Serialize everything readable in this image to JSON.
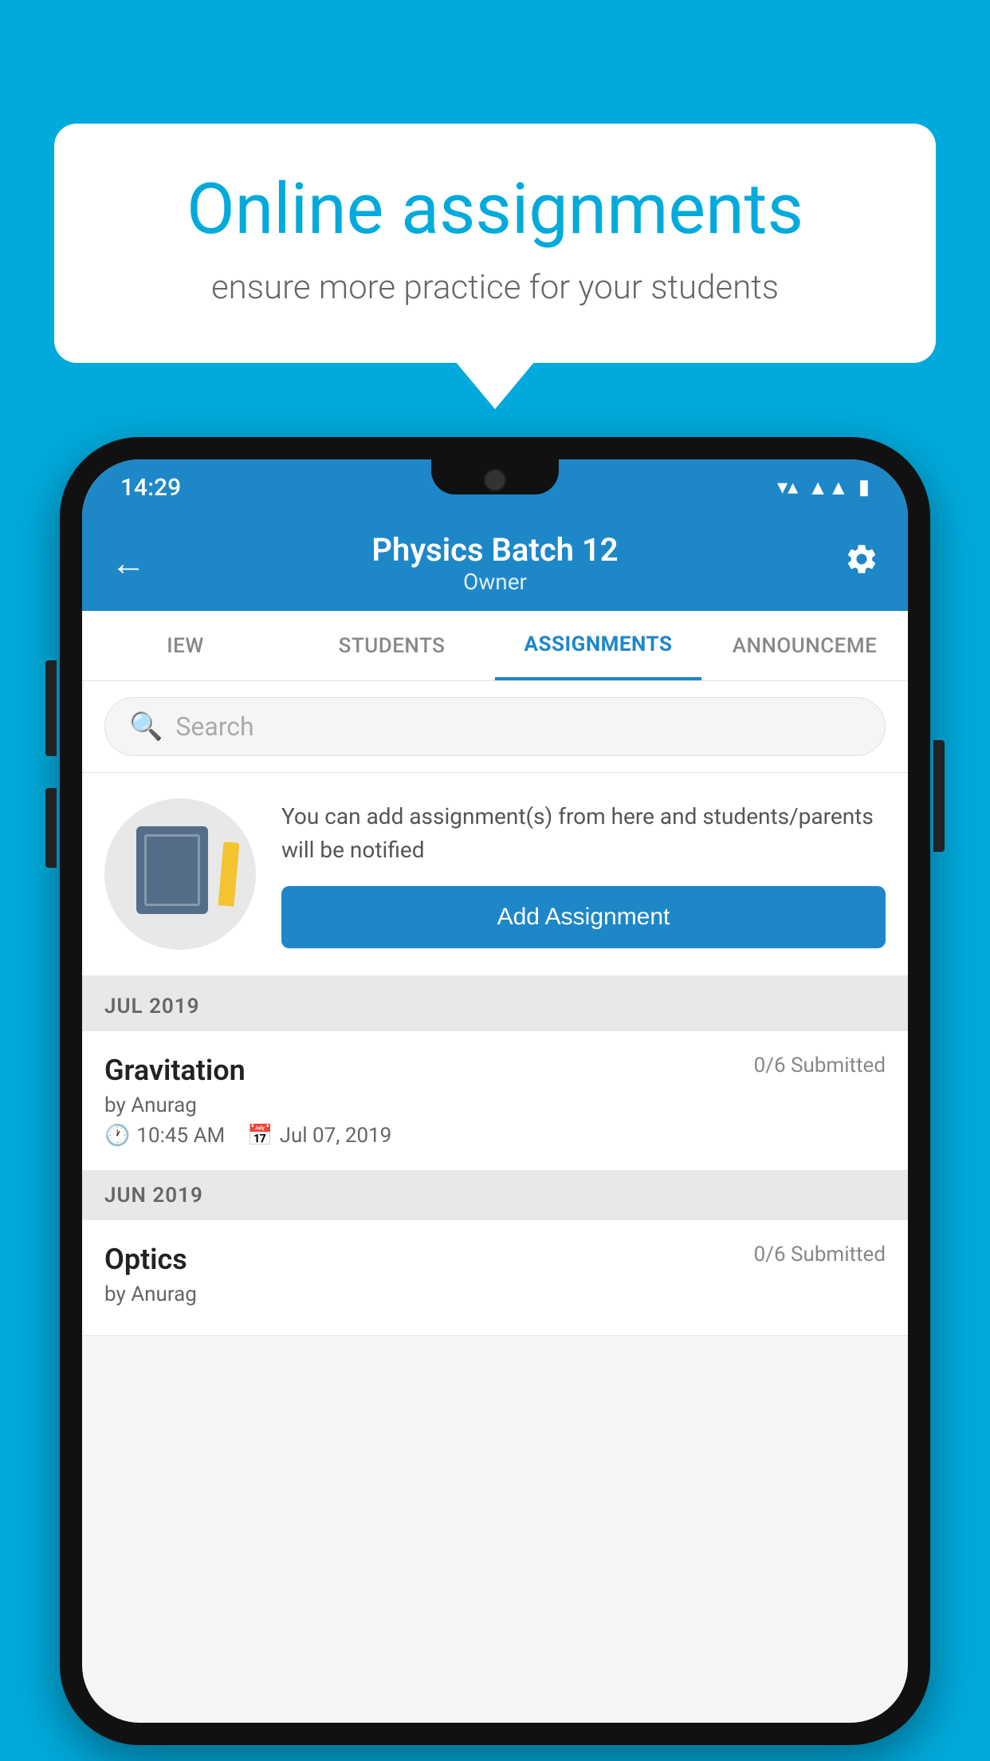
{
  "background": {
    "color": "#00AADC"
  },
  "speech_bubble": {
    "title": "Online assignments",
    "subtitle": "ensure more practice for your students"
  },
  "status_bar": {
    "time": "14:29",
    "wifi_icon": "▼",
    "signal_icon": "▲",
    "battery_icon": "▮"
  },
  "header": {
    "title": "Physics Batch 12",
    "subtitle": "Owner",
    "back_icon": "←",
    "settings_icon": "⚙"
  },
  "tabs": [
    {
      "label": "IEW",
      "active": false
    },
    {
      "label": "STUDENTS",
      "active": false
    },
    {
      "label": "ASSIGNMENTS",
      "active": true
    },
    {
      "label": "ANNOUNCEME",
      "active": false
    }
  ],
  "search": {
    "placeholder": "Search"
  },
  "promo": {
    "description": "You can add assignment(s) from here and students/parents will be notified",
    "button_label": "Add Assignment"
  },
  "sections": [
    {
      "month": "JUL 2019",
      "assignments": [
        {
          "name": "Gravitation",
          "submitted": "0/6 Submitted",
          "by": "by Anurag",
          "time": "10:45 AM",
          "date": "Jul 07, 2019"
        }
      ]
    },
    {
      "month": "JUN 2019",
      "assignments": [
        {
          "name": "Optics",
          "submitted": "0/6 Submitted",
          "by": "by Anurag",
          "time": "",
          "date": ""
        }
      ]
    }
  ]
}
